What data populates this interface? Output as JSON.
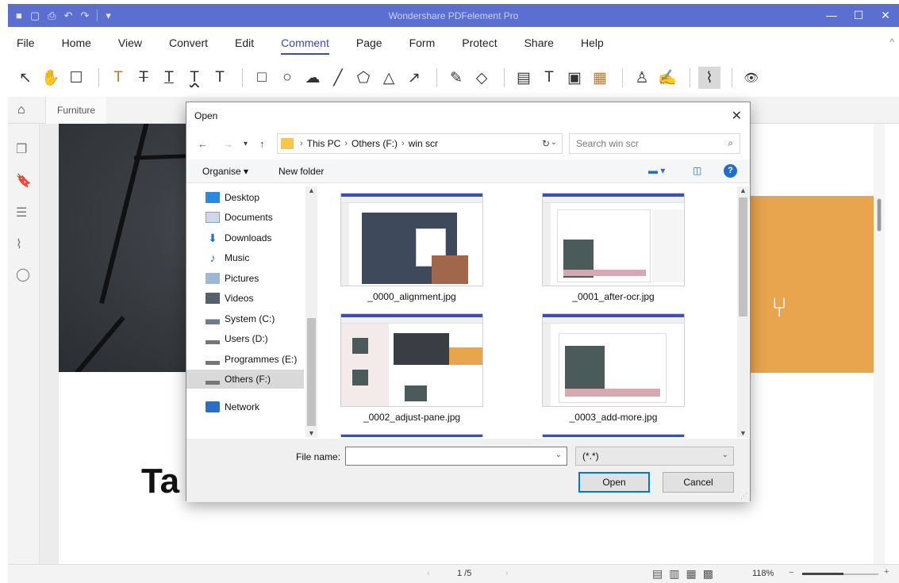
{
  "app": {
    "title": "Wondershare PDFelement Pro",
    "quick_access": [
      "■",
      "▢",
      "⎙",
      "↶",
      "↷",
      "▾"
    ],
    "window_controls": [
      "—",
      "☐",
      "✕"
    ]
  },
  "menu": {
    "items": [
      "File",
      "Home",
      "View",
      "Convert",
      "Edit",
      "Comment",
      "Page",
      "Form",
      "Protect",
      "Share",
      "Help"
    ],
    "active": "Comment",
    "collapse": "^"
  },
  "toolbar": {
    "glyphs": {
      "select": "↖",
      "hand": "✋",
      "sticky_note": "☐",
      "highlight": "T",
      "strikethrough": "T",
      "underline": "T",
      "squiggly": "T",
      "caret": "T",
      "rectangle": "□",
      "oval": "○",
      "cloud": "☁",
      "arrow_line": "╱",
      "polygon": "⬠",
      "polyline": "△",
      "arrow": "↗",
      "pencil": "✎",
      "eraser": "◇",
      "text_box": "▤",
      "typewriter": "T",
      "text_callout": "▣",
      "area_highlight": "▦",
      "stamp": "♙",
      "signature": "✍",
      "attach_file": "⌇",
      "hide_comments": "👁"
    }
  },
  "tabs": {
    "home_glyph": "⌂",
    "document_tab": "Furniture"
  },
  "leftpanel": {
    "glyphs": [
      "❐",
      "🔖",
      "☰",
      "⌇",
      "◯"
    ],
    "collapse_arrow": "›"
  },
  "document": {
    "visible_title_fragment": "Ta",
    "chair_glyph": "⑂"
  },
  "statusbar": {
    "prev": "‹",
    "page": "1 /5",
    "next": "›",
    "view_glyphs": [
      "▤",
      "▥",
      "▦",
      "▩"
    ],
    "zoom": "118%",
    "zoom_minus": "−",
    "zoom_plus": "+",
    "zoom_level": 0.54
  },
  "dialog": {
    "title": "Open",
    "close": "✕",
    "nav": {
      "back": "←",
      "forward": "→",
      "recent": "▾",
      "up": "↑"
    },
    "breadcrumb": [
      "This PC",
      "Others (F:)",
      "win scr"
    ],
    "breadcrumb_sep": "›",
    "dropdown": "⌄",
    "refresh": "↻",
    "search_placeholder": "Search win scr",
    "search_glyph": "⌕",
    "organise": "Organise ▾",
    "new_folder": "New folder",
    "view_glyph": "▬ ▾",
    "preview_glyph": "◫",
    "help_glyph": "?",
    "nav_items": [
      {
        "label": "Desktop",
        "color": "#2b8ae0"
      },
      {
        "label": "Documents",
        "color": "#cfd8e8"
      },
      {
        "label": "Downloads",
        "color": "#2b6fc4"
      },
      {
        "label": "Music",
        "color": "#2b6fc4"
      },
      {
        "label": "Pictures",
        "color": "#9fb6d4"
      },
      {
        "label": "Videos",
        "color": "#56606c"
      },
      {
        "label": "System (C:)",
        "color": "#6c7a8a"
      },
      {
        "label": "Users (D:)",
        "color": "#777"
      },
      {
        "label": "Programmes (E:)",
        "color": "#777"
      },
      {
        "label": "Others (F:)",
        "color": "#777"
      },
      {
        "label": "Network",
        "color": "#2b6fc4"
      }
    ],
    "selected_nav": "Others (F:)",
    "files": [
      "_0000_alignment.jpg",
      "_0001_after-ocr.jpg",
      "_0002_adjust-pane.jpg",
      "_0003_add-more.jpg"
    ],
    "file_name_label": "File name:",
    "file_name_value": "",
    "file_type": "(*.*)",
    "open_button": "Open",
    "cancel_button": "Cancel",
    "scroll_up": "▲",
    "scroll_down": "▼",
    "grip": "⋰"
  },
  "colors": {
    "titlebar": "#5b6fd0",
    "accent": "#3a4ab7",
    "orange_panel": "#e9a44e",
    "primary_button_border": "#0078d7"
  }
}
